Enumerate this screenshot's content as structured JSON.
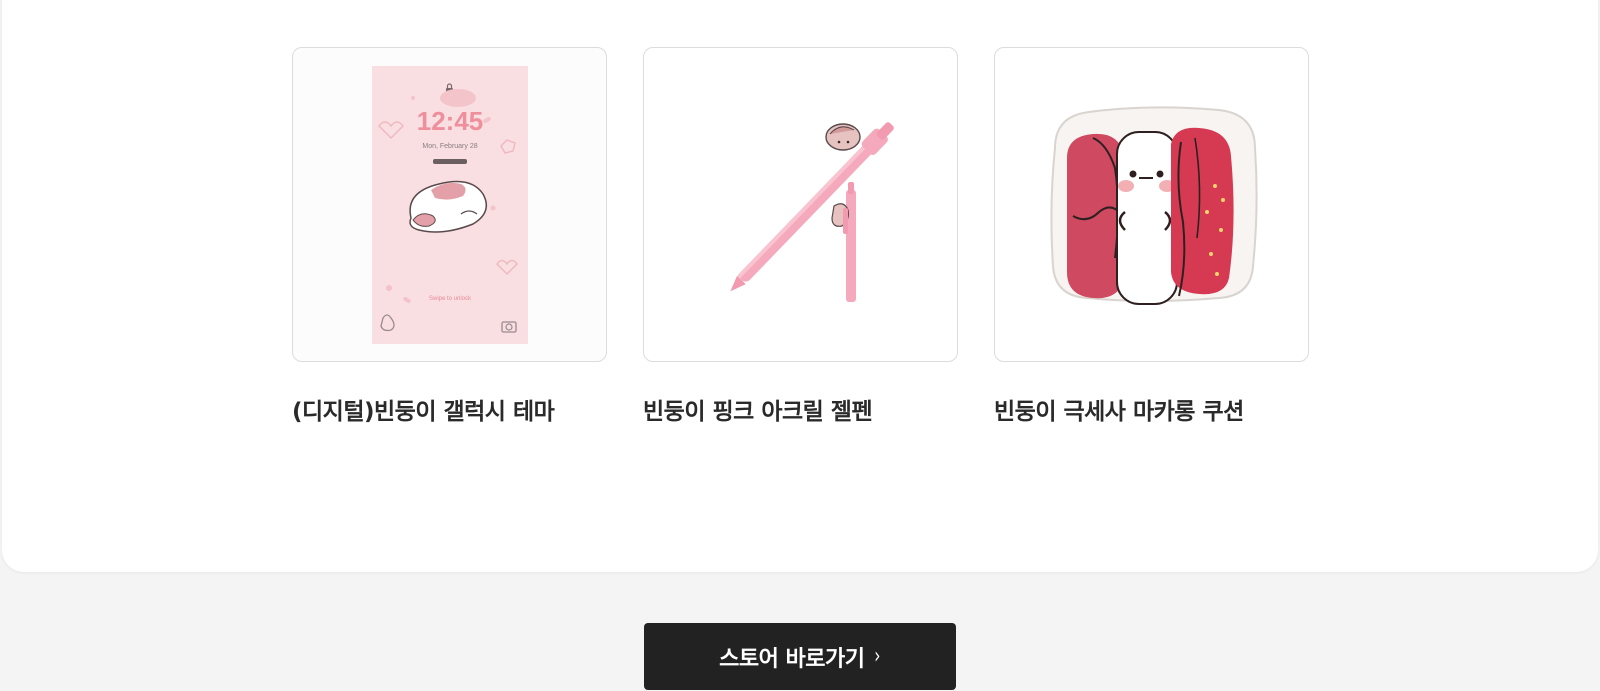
{
  "products": [
    {
      "name": "(디지털)빈둥이 갤럭시 테마",
      "image_icon": "phone-lockscreen-theme",
      "screen": {
        "time": "12:45",
        "date": "Mon, February 28",
        "unlock_hint": "Swipe to unlock"
      }
    },
    {
      "name": "빈둥이 핑크 아크릴 젤펜",
      "image_icon": "pink-gel-pen"
    },
    {
      "name": "빈둥이 극세사 마카롱 쿠션",
      "image_icon": "macaron-cushion"
    }
  ],
  "store_button": {
    "label": "스토어 바로가기",
    "icon": "chevron-right-icon",
    "glyph": "›"
  },
  "colors": {
    "button_bg": "#222222",
    "pink": "#f7dadd",
    "accent": "#e36f7e"
  }
}
